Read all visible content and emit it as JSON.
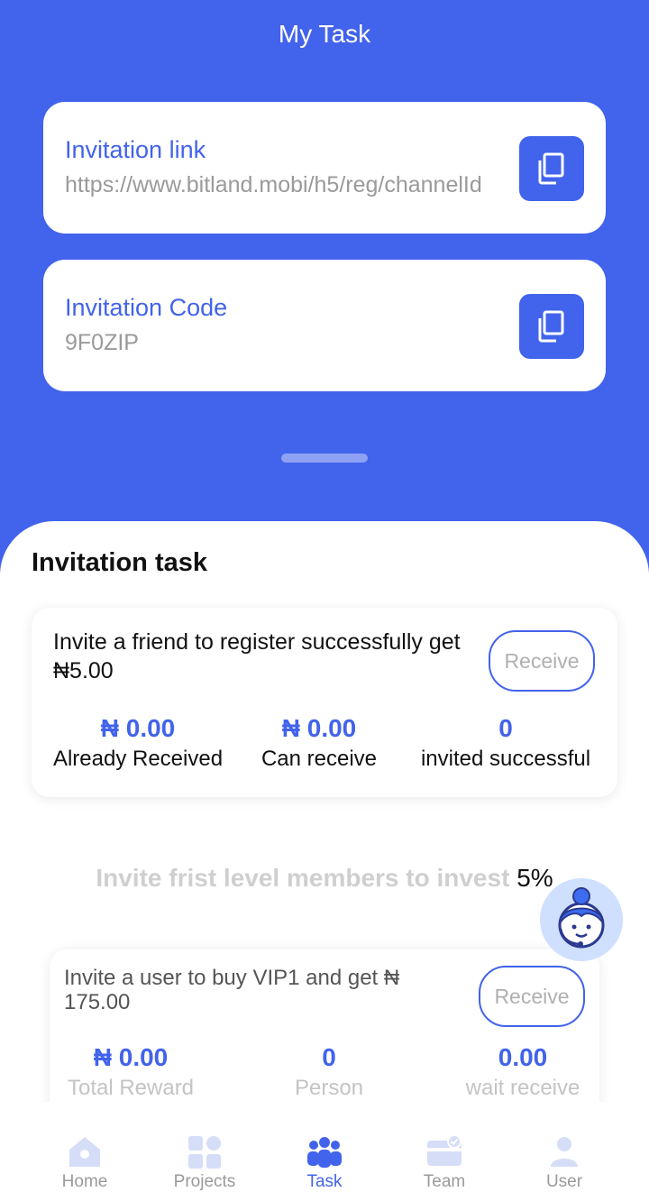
{
  "header": {
    "title": "My Task"
  },
  "invitation_link": {
    "label": "Invitation link",
    "value": "https://www.bitland.mobi/h5/reg/channelId",
    "copy_icon": "copy-icon"
  },
  "invitation_code": {
    "label": "Invitation Code",
    "value": "9F0ZIP",
    "copy_icon": "copy-icon"
  },
  "section": {
    "title": "Invitation task"
  },
  "task1": {
    "description": "Invite a friend to register successfully get ₦5.00",
    "receive_label": "Receive",
    "stats": [
      {
        "value": "₦ 0.00",
        "label": "Already Received"
      },
      {
        "value": "₦ 0.00",
        "label": "Can receive"
      },
      {
        "value": "0",
        "label": "invited successful"
      }
    ]
  },
  "invest": {
    "text": "Invite frist level members to invest",
    "percent": "5%"
  },
  "task2": {
    "description": "Invite a user to buy VIP1 and get ₦ 175.00",
    "receive_label": "Receive",
    "stats": [
      {
        "value": "₦ 0.00",
        "label": "Total Reward"
      },
      {
        "value": "0",
        "label": "Person"
      },
      {
        "value": "0.00",
        "label": "wait receive"
      }
    ]
  },
  "support": {
    "icon": "customer-service-icon"
  },
  "tabs": [
    {
      "label": "Home",
      "icon": "home-icon"
    },
    {
      "label": "Projects",
      "icon": "grid-icon"
    },
    {
      "label": "Task",
      "icon": "team-people-icon"
    },
    {
      "label": "Team",
      "icon": "card-check-icon"
    },
    {
      "label": "User",
      "icon": "user-icon"
    }
  ],
  "active_tab": "Task",
  "colors": {
    "primary": "#4263eb",
    "muted": "#9a9a9a",
    "tab_inactive": "#d6ddf7"
  }
}
